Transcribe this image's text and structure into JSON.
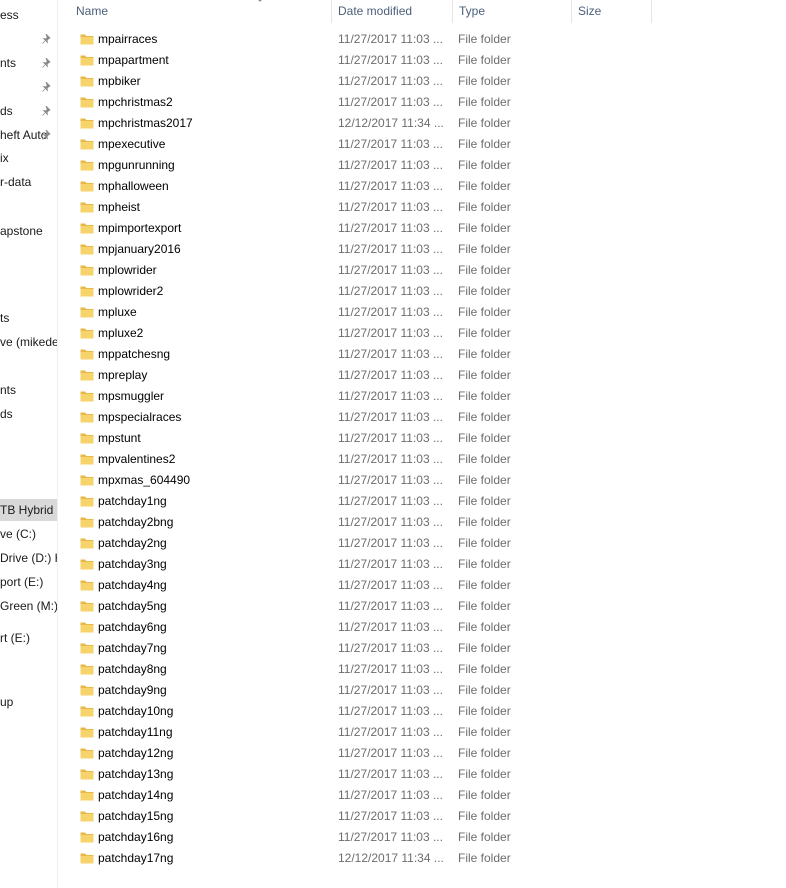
{
  "nav": {
    "items": [
      {
        "label": "ess",
        "pinned": false
      },
      {
        "label": "",
        "pinned": true
      },
      {
        "label": "nts",
        "pinned": true
      },
      {
        "label": "",
        "pinned": true
      },
      {
        "label": "ds",
        "pinned": true
      },
      {
        "label": "heft Auto",
        "pinned": true
      },
      {
        "label": "ix",
        "pinned": false
      },
      {
        "label": "r-data",
        "pinned": false
      },
      {
        "label": "apstone",
        "pinned": false
      },
      {
        "label": "ts",
        "pinned": false
      },
      {
        "label": "ve (mikede",
        "pinned": false
      },
      {
        "label": "nts",
        "pinned": false
      },
      {
        "label": "ds",
        "pinned": false
      },
      {
        "label": "TB Hybrid",
        "pinned": false
      },
      {
        "label": "ve (C:)",
        "pinned": false
      },
      {
        "label": "Drive (D:) H",
        "pinned": false
      },
      {
        "label": "port (E:)",
        "pinned": false
      },
      {
        "label": "Green (M:)",
        "pinned": false
      },
      {
        "label": "rt (E:)",
        "pinned": false
      },
      {
        "label": "up",
        "pinned": false
      }
    ]
  },
  "columns": {
    "name": "Name",
    "date": "Date modified",
    "type": "Type",
    "size": "Size"
  },
  "colors": {
    "folder": "#f6d36b",
    "folder_dark": "#e7b94a",
    "header_text": "#4c607a",
    "meta_text": "#6d6d6d"
  },
  "files": [
    {
      "name": "mpairraces",
      "date": "11/27/2017 11:03 ...",
      "type": "File folder"
    },
    {
      "name": "mpapartment",
      "date": "11/27/2017 11:03 ...",
      "type": "File folder"
    },
    {
      "name": "mpbiker",
      "date": "11/27/2017 11:03 ...",
      "type": "File folder"
    },
    {
      "name": "mpchristmas2",
      "date": "11/27/2017 11:03 ...",
      "type": "File folder"
    },
    {
      "name": "mpchristmas2017",
      "date": "12/12/2017 11:34 ...",
      "type": "File folder"
    },
    {
      "name": "mpexecutive",
      "date": "11/27/2017 11:03 ...",
      "type": "File folder"
    },
    {
      "name": "mpgunrunning",
      "date": "11/27/2017 11:03 ...",
      "type": "File folder"
    },
    {
      "name": "mphalloween",
      "date": "11/27/2017 11:03 ...",
      "type": "File folder"
    },
    {
      "name": "mpheist",
      "date": "11/27/2017 11:03 ...",
      "type": "File folder"
    },
    {
      "name": "mpimportexport",
      "date": "11/27/2017 11:03 ...",
      "type": "File folder"
    },
    {
      "name": "mpjanuary2016",
      "date": "11/27/2017 11:03 ...",
      "type": "File folder"
    },
    {
      "name": "mplowrider",
      "date": "11/27/2017 11:03 ...",
      "type": "File folder"
    },
    {
      "name": "mplowrider2",
      "date": "11/27/2017 11:03 ...",
      "type": "File folder"
    },
    {
      "name": "mpluxe",
      "date": "11/27/2017 11:03 ...",
      "type": "File folder"
    },
    {
      "name": "mpluxe2",
      "date": "11/27/2017 11:03 ...",
      "type": "File folder"
    },
    {
      "name": "mppatchesng",
      "date": "11/27/2017 11:03 ...",
      "type": "File folder"
    },
    {
      "name": "mpreplay",
      "date": "11/27/2017 11:03 ...",
      "type": "File folder"
    },
    {
      "name": "mpsmuggler",
      "date": "11/27/2017 11:03 ...",
      "type": "File folder"
    },
    {
      "name": "mpspecialraces",
      "date": "11/27/2017 11:03 ...",
      "type": "File folder"
    },
    {
      "name": "mpstunt",
      "date": "11/27/2017 11:03 ...",
      "type": "File folder"
    },
    {
      "name": "mpvalentines2",
      "date": "11/27/2017 11:03 ...",
      "type": "File folder"
    },
    {
      "name": "mpxmas_604490",
      "date": "11/27/2017 11:03 ...",
      "type": "File folder"
    },
    {
      "name": "patchday1ng",
      "date": "11/27/2017 11:03 ...",
      "type": "File folder"
    },
    {
      "name": "patchday2bng",
      "date": "11/27/2017 11:03 ...",
      "type": "File folder"
    },
    {
      "name": "patchday2ng",
      "date": "11/27/2017 11:03 ...",
      "type": "File folder"
    },
    {
      "name": "patchday3ng",
      "date": "11/27/2017 11:03 ...",
      "type": "File folder"
    },
    {
      "name": "patchday4ng",
      "date": "11/27/2017 11:03 ...",
      "type": "File folder"
    },
    {
      "name": "patchday5ng",
      "date": "11/27/2017 11:03 ...",
      "type": "File folder"
    },
    {
      "name": "patchday6ng",
      "date": "11/27/2017 11:03 ...",
      "type": "File folder"
    },
    {
      "name": "patchday7ng",
      "date": "11/27/2017 11:03 ...",
      "type": "File folder"
    },
    {
      "name": "patchday8ng",
      "date": "11/27/2017 11:03 ...",
      "type": "File folder"
    },
    {
      "name": "patchday9ng",
      "date": "11/27/2017 11:03 ...",
      "type": "File folder"
    },
    {
      "name": "patchday10ng",
      "date": "11/27/2017 11:03 ...",
      "type": "File folder"
    },
    {
      "name": "patchday11ng",
      "date": "11/27/2017 11:03 ...",
      "type": "File folder"
    },
    {
      "name": "patchday12ng",
      "date": "11/27/2017 11:03 ...",
      "type": "File folder"
    },
    {
      "name": "patchday13ng",
      "date": "11/27/2017 11:03 ...",
      "type": "File folder"
    },
    {
      "name": "patchday14ng",
      "date": "11/27/2017 11:03 ...",
      "type": "File folder"
    },
    {
      "name": "patchday15ng",
      "date": "11/27/2017 11:03 ...",
      "type": "File folder"
    },
    {
      "name": "patchday16ng",
      "date": "11/27/2017 11:03 ...",
      "type": "File folder"
    },
    {
      "name": "patchday17ng",
      "date": "12/12/2017 11:34 ...",
      "type": "File folder"
    }
  ]
}
